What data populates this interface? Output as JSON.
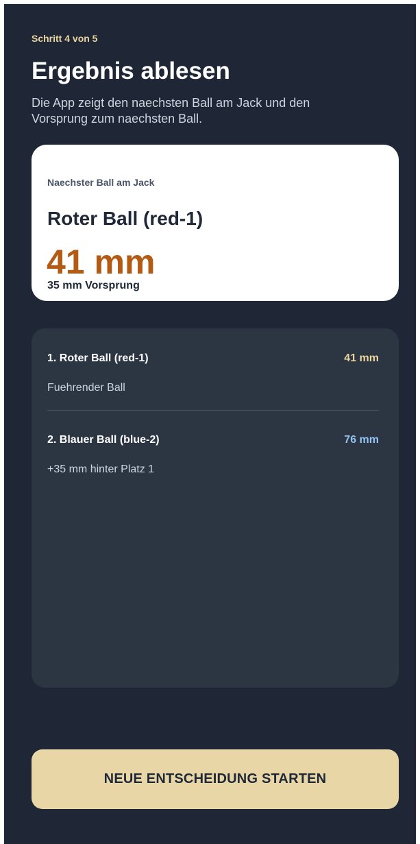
{
  "header": {
    "step": "Schritt 4 von 5",
    "title": "Ergebnis ablesen",
    "subtitle": "Die App zeigt den naechsten Ball am Jack und den Vorsprung zum naechsten Ball."
  },
  "result": {
    "label": "Naechster Ball am Jack",
    "ball": "Roter Ball (red-1)",
    "distance": "41 mm",
    "lead": "35 mm Vorsprung"
  },
  "ranking": [
    {
      "name": "1. Roter Ball (red-1)",
      "value": "41 mm",
      "note": "Fuehrender Ball",
      "color": "#e9d49e"
    },
    {
      "name": "2. Blauer Ball (blue-2)",
      "value": "76 mm",
      "note": "+35 mm hinter Platz 1",
      "color": "#93c2f2"
    }
  ],
  "actions": {
    "primary": "NEUE ENTSCHEIDUNG STARTEN"
  },
  "colors": {
    "background": "#1f2736",
    "accent": "#e9d49e",
    "result_orange": "#b35a13",
    "button": "#e9d6a7"
  }
}
